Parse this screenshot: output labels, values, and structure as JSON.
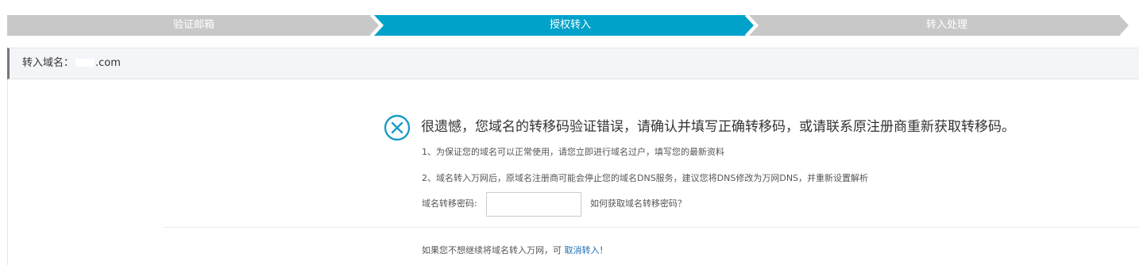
{
  "steps": [
    {
      "label": "验证邮箱",
      "state": "done"
    },
    {
      "label": "授权转入",
      "state": "active"
    },
    {
      "label": "转入处理",
      "state": "pending"
    }
  ],
  "colors": {
    "step_inactive": "#c8c8c8",
    "step_active": "#00a2ca",
    "header_bg": "#f4f5f9",
    "icon": "#1a9bc6",
    "link": "#1e6fb5"
  },
  "domain": {
    "label": "转入域名：",
    "suffix": ".com"
  },
  "error": {
    "icon": "x-circle-icon",
    "headline": "很遗憾，您域名的转移码验证错误，请确认并填写正确转移码，或请联系原注册商重新获取转移码。",
    "tips": [
      "1、为保证您的域名可以正常使用，请您立即进行域名过户，填写您的最新资料",
      "2、域名转入万网后，原域名注册商可能会停止您的域名DNS服务，建议您将DNS修改为万网DNS，并重新设置解析"
    ]
  },
  "form": {
    "code_label": "域名转移密码:",
    "code_value": "",
    "help_link": "如何获取域名转移密码？"
  },
  "footer": {
    "prefix": "如果您不想继续将域名转入万网，可 ",
    "cancel_link": "取消转入",
    "suffix": "！"
  }
}
